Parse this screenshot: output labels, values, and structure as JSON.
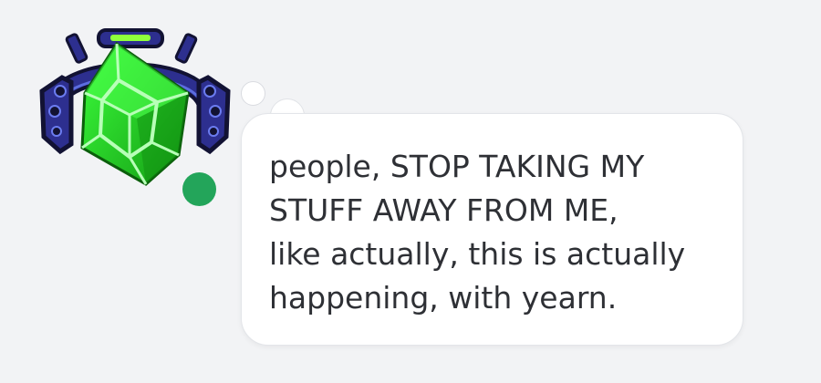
{
  "message": {
    "text": "people, STOP TAKING MY\nSTUFF AWAY FROM ME,\nlike actually, this is actually\nhappening, with yearn."
  },
  "avatar": {
    "icon": "green-tesseract-with-headphones",
    "status": "online",
    "status_color": "#23a55a"
  },
  "colors": {
    "background": "#f2f3f5",
    "bubble": "#ffffff",
    "text": "#2e3035",
    "accent_green": "#2cff2c",
    "headphone_blue": "#2d2f8f"
  }
}
